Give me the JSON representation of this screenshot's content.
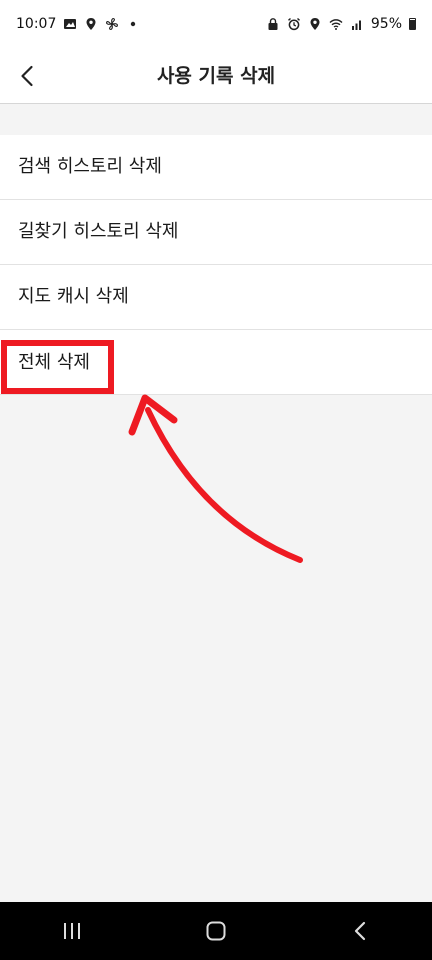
{
  "status_bar": {
    "time": "10:07",
    "battery": "95%",
    "icons_left": [
      "image-icon",
      "location-icon",
      "fan-icon",
      "dot-icon"
    ],
    "icons_right": [
      "lock-icon",
      "alarm-icon",
      "location-icon",
      "wifi-icon",
      "signal-icon",
      "battery-icon"
    ]
  },
  "header": {
    "title": "사용 기록 삭제",
    "back_icon": "chevron-left-icon"
  },
  "menu": {
    "items": [
      {
        "label": "검색 히스토리 삭제"
      },
      {
        "label": "길찾기 히스토리 삭제"
      },
      {
        "label": "지도 캐시 삭제"
      },
      {
        "label": "전체 삭제"
      }
    ]
  },
  "annotation": {
    "highlight_color": "#ee1a22",
    "target": "전체 삭제"
  },
  "nav_bar": {
    "buttons": [
      "recent-apps-icon",
      "home-icon",
      "back-icon"
    ]
  }
}
